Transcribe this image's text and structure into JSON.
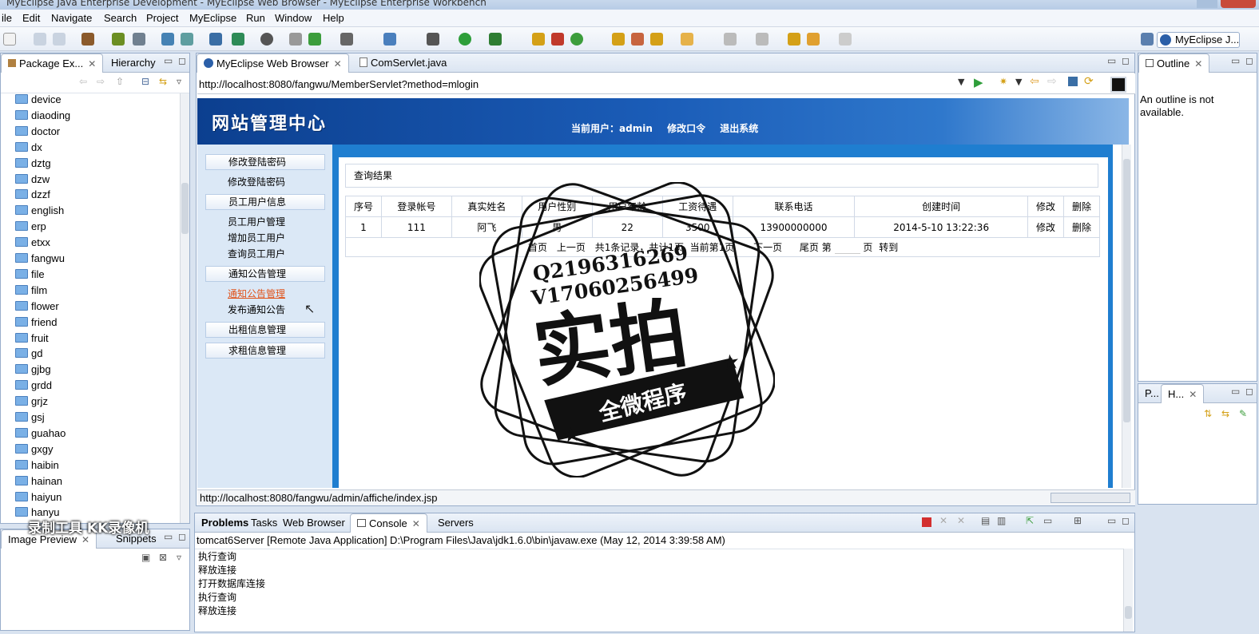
{
  "window": {
    "title": "MyEclipse Java Enterprise Development - MyEclipse Web Browser - MyEclipse Enterprise Workbench"
  },
  "menu": [
    "ile",
    "Edit",
    "Navigate",
    "Search",
    "Project",
    "MyEclipse",
    "Run",
    "Window",
    "Help"
  ],
  "perspective": {
    "label": "MyEclipse J..."
  },
  "package_explorer": {
    "tabs": [
      "Package Ex...",
      "Hierarchy"
    ],
    "items": [
      "device",
      "diaoding",
      "doctor",
      "dx",
      "dztg",
      "dzw",
      "dzzf",
      "english",
      "erp",
      "etxx",
      "fangwu",
      "file",
      "film",
      "flower",
      "friend",
      "fruit",
      "gd",
      "gjbg",
      "grdd",
      "grjz",
      "gsj",
      "guahao",
      "gxgy",
      "haibin",
      "hainan",
      "haiyun",
      "hanyu"
    ]
  },
  "editor": {
    "tabs": [
      "MyEclipse Web Browser",
      "ComServlet.java"
    ],
    "url": "http://localhost:8080/fangwu/MemberServlet?method=mlogin",
    "status_url": "http://localhost:8080/fangwu/admin/affiche/index.jsp"
  },
  "site": {
    "logo": "网站管理中心",
    "user_label": "当前用户：",
    "user_name": "admin",
    "change_pwd": "修改口令",
    "logout": "退出系统",
    "menu": [
      {
        "head": "修改登陆密码",
        "items": [
          "修改登陆密码"
        ]
      },
      {
        "head": "员工用户信息",
        "items": [
          "员工用户管理",
          "增加员工用户",
          "查询员工用户"
        ]
      },
      {
        "head": "通知公告管理",
        "items": [
          "通知公告管理",
          "发布通知公告"
        ]
      },
      {
        "head": "出租信息管理",
        "items": []
      },
      {
        "head": "求租信息管理",
        "items": []
      }
    ],
    "result_title": "查询结果",
    "table": {
      "headers": [
        "序号",
        "登录帐号",
        "真实姓名",
        "用户性别",
        "用户年龄",
        "工资待遇",
        "联系电话",
        "创建时间",
        "修改",
        "删除"
      ],
      "rows": [
        [
          "1",
          "111",
          "阿飞",
          "男",
          "22",
          "3500",
          "13900000000",
          "2014-5-10 13:22:36",
          "修改",
          "删除"
        ]
      ]
    },
    "pager": {
      "first": "首页",
      "prev": "上一页",
      "summary": "共1条记录，共计1页, 当前第1页",
      "next": "下一页",
      "last": "尾页",
      "page_label": "第",
      "page_suffix": "页",
      "goto": "转到"
    }
  },
  "outline": {
    "title": "Outline",
    "message": "An outline is not available."
  },
  "right_bottom_tabs": [
    "P...",
    "H..."
  ],
  "image_preview": {
    "tabs": [
      "Image Preview",
      "Snippets"
    ]
  },
  "bottom": {
    "tabs": [
      "Problems",
      "Tasks",
      "Web Browser",
      "Console",
      "Servers"
    ],
    "console_header": "tomcat6Server [Remote Java Application] D:\\Program Files\\Java\\jdk1.6.0\\bin\\javaw.exe (May 12, 2014 3:39:58 AM)",
    "lines": [
      "执行查询",
      "释放连接",
      "打开数据库连接",
      "执行查询",
      "释放连接"
    ]
  },
  "watermark": {
    "line1": "Q2196316269",
    "line2": "V17060256499",
    "big": "实拍",
    "ribbon": "全微程序"
  },
  "recorder": {
    "text": "录制工具 KK录像机"
  }
}
